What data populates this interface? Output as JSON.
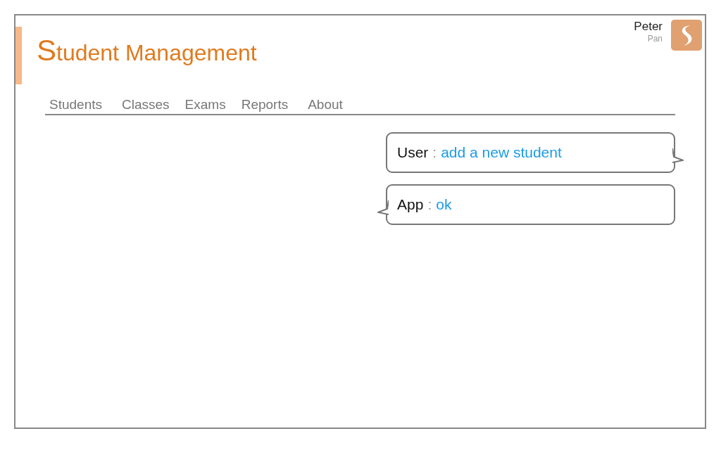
{
  "header": {
    "title": "Student Management",
    "user": {
      "first_name": "Peter",
      "last_name": "Pan"
    }
  },
  "nav": [
    {
      "label": "Students"
    },
    {
      "label": "Classes"
    },
    {
      "label": "Exams"
    },
    {
      "label": "Reports"
    },
    {
      "label": "About"
    }
  ],
  "messages": [
    {
      "kind": "user",
      "speaker": "User",
      "separator": ":",
      "text": "add a new student"
    },
    {
      "kind": "app",
      "speaker": "App",
      "separator": ":",
      "text": "ok"
    }
  ]
}
